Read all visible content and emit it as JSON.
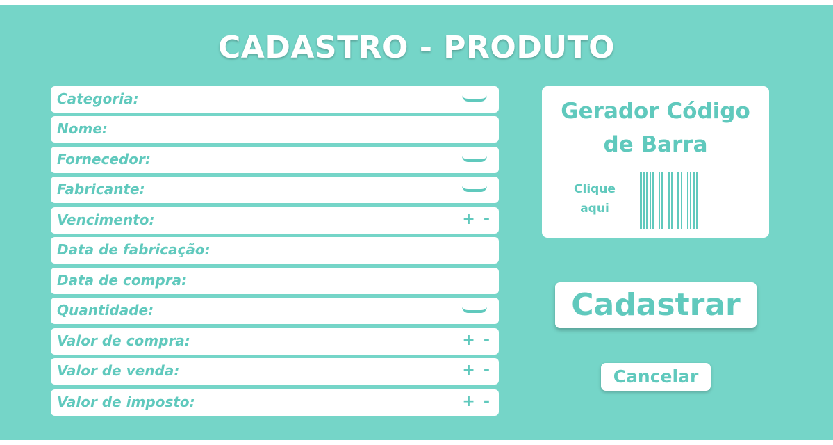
{
  "page": {
    "title": "CADASTRO - PRODUTO"
  },
  "colors": {
    "background": "#75d5c8",
    "accent": "#60c9bd",
    "panel": "#ffffff"
  },
  "form": {
    "fields": [
      {
        "label": "Categoria:",
        "control": "dropdown",
        "icon": "chevron-down-icon"
      },
      {
        "label": "Nome:",
        "control": "text"
      },
      {
        "label": "Fornecedor:",
        "control": "dropdown",
        "icon": "chevron-down-icon"
      },
      {
        "label": "Fabricante:",
        "control": "dropdown",
        "icon": "chevron-down-icon"
      },
      {
        "label": "Vencimento:",
        "control": "stepper",
        "plus": "+",
        "minus": "-"
      },
      {
        "label": "Data de fabricação:",
        "control": "text"
      },
      {
        "label": "Data de compra:",
        "control": "text"
      },
      {
        "label": "Quantidade:",
        "control": "dropdown",
        "icon": "chevron-down-icon"
      },
      {
        "label": "Valor de compra:",
        "control": "stepper",
        "plus": "+",
        "minus": "-"
      },
      {
        "label": "Valor de venda:",
        "control": "stepper",
        "plus": "+",
        "minus": "-"
      },
      {
        "label": "Valor de imposto:",
        "control": "stepper",
        "plus": "+",
        "minus": "-"
      }
    ]
  },
  "barcode": {
    "title_line1": "Gerador Código",
    "title_line2": "de Barra",
    "cta_line1": "Clique",
    "cta_line2": "aqui",
    "icon": "barcode-icon"
  },
  "actions": {
    "register_label": "Cadastrar",
    "cancel_label": "Cancelar"
  }
}
